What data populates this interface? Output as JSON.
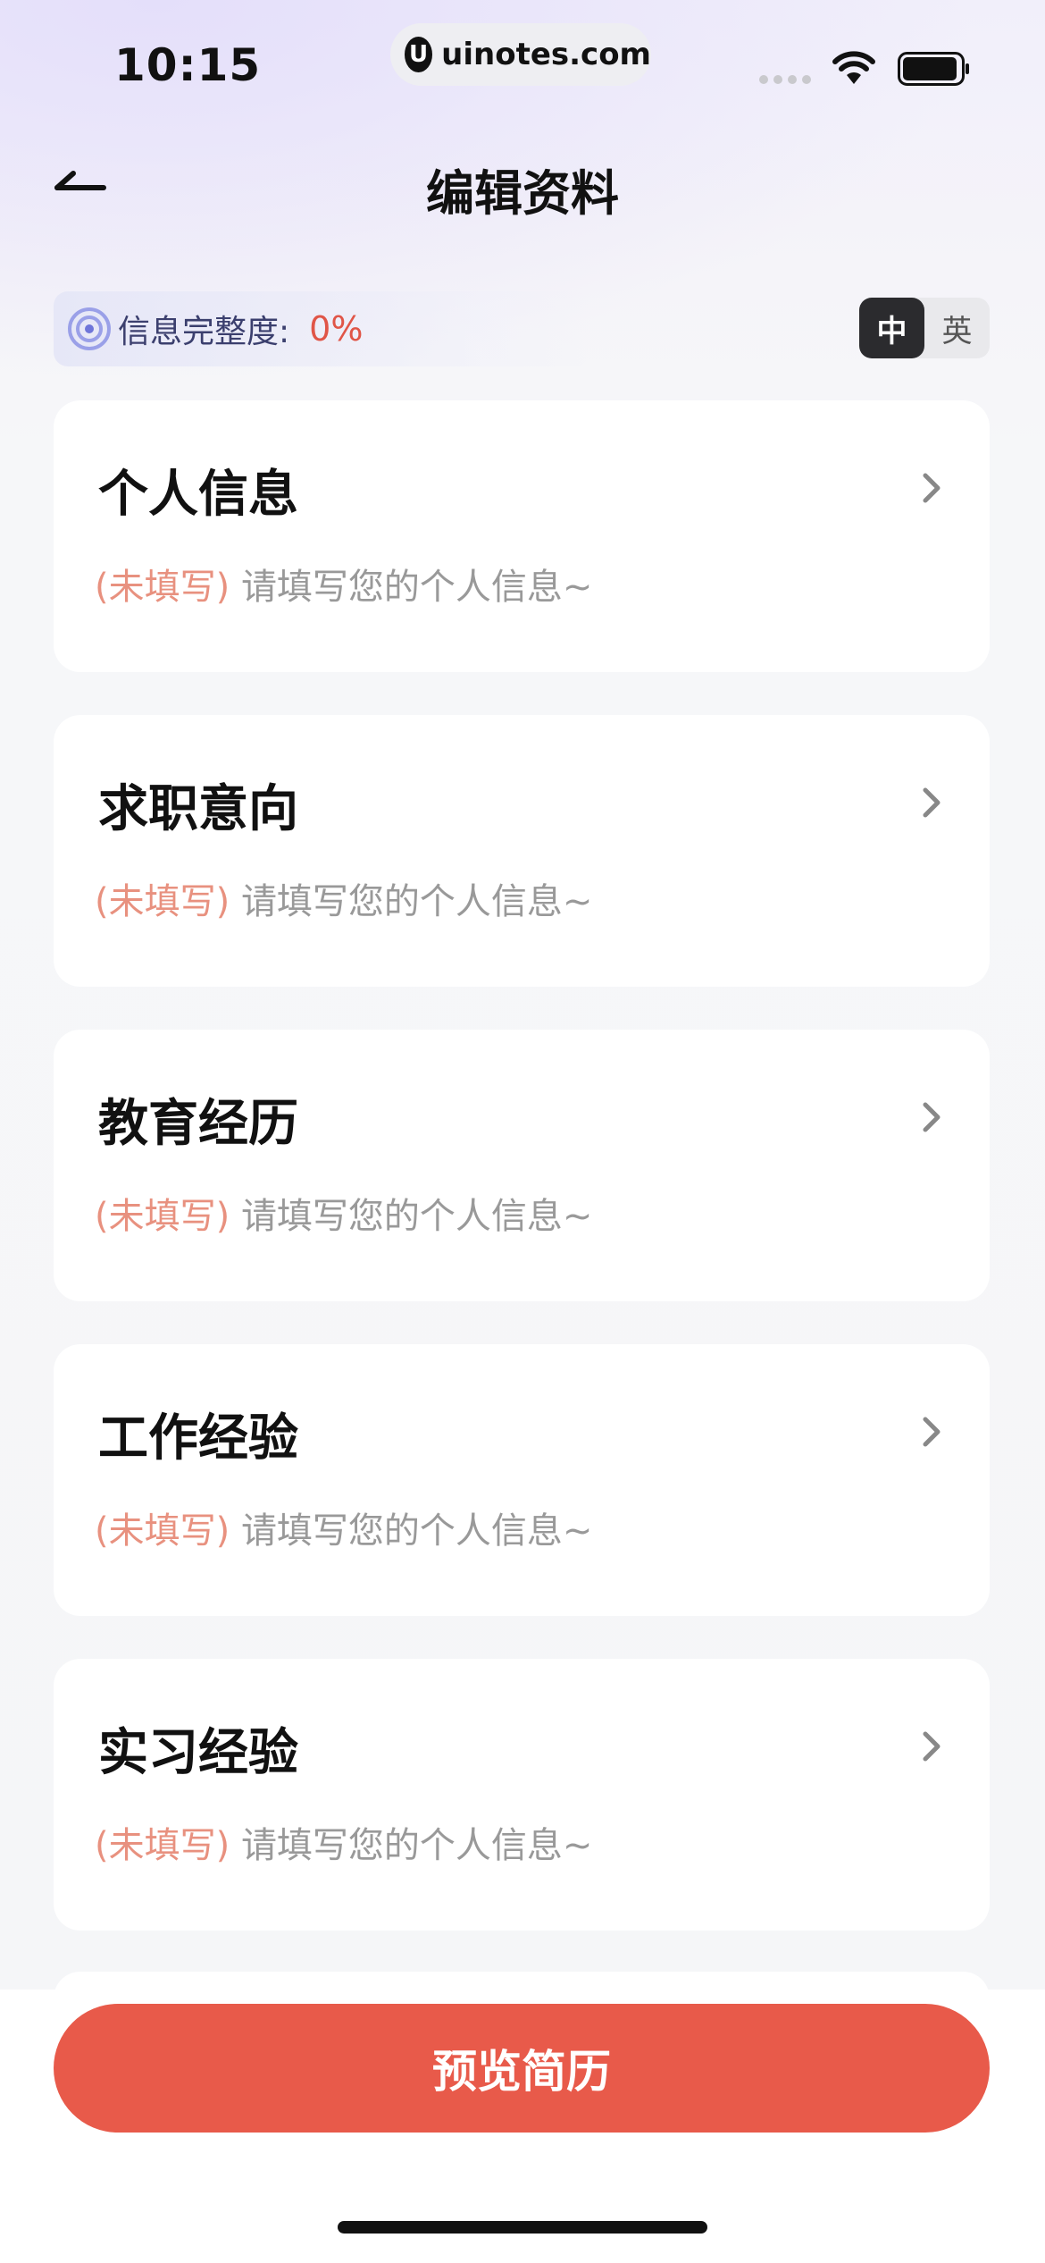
{
  "status_bar": {
    "time": "10:15",
    "url": "uinotes.com",
    "url_logo": "U"
  },
  "header": {
    "title": "编辑资料"
  },
  "completeness": {
    "label": "信息完整度:",
    "value": "0%"
  },
  "language_toggle": {
    "options": [
      "中",
      "英"
    ],
    "selected": "中"
  },
  "cards": [
    {
      "title": "个人信息",
      "status": "(未填写)",
      "hint": "请填写您的个人信息~"
    },
    {
      "title": "求职意向",
      "status": "(未填写)",
      "hint": "请填写您的个人信息~"
    },
    {
      "title": "教育经历",
      "status": "(未填写)",
      "hint": "请填写您的个人信息~"
    },
    {
      "title": "工作经验",
      "status": "(未填写)",
      "hint": "请填写您的个人信息~"
    },
    {
      "title": "实习经验",
      "status": "(未填写)",
      "hint": "请填写您的个人信息~"
    }
  ],
  "preview_button": {
    "label": "预览简历"
  },
  "colors": {
    "accent": "#e85a4a",
    "unfilled": "#e8917f",
    "completeness_value": "#e05547"
  }
}
